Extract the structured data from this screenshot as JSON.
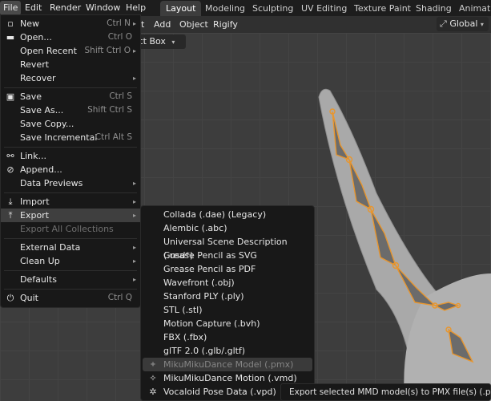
{
  "topbar": {
    "menus": [
      "File",
      "Edit",
      "Render",
      "Window",
      "Help"
    ],
    "workspaces": [
      "Layout",
      "Modeling",
      "Sculpting",
      "UV Editing",
      "Texture Paint",
      "Shading",
      "Animatio"
    ]
  },
  "header": {
    "mode_menu_fragment": "t",
    "menus": [
      "Add",
      "Object",
      "Rigify"
    ],
    "transform_orientation": "Global"
  },
  "toolbar": {
    "select_box": "elect Box"
  },
  "file_menu": {
    "new": {
      "label": "New",
      "shortcut": "Ctrl N"
    },
    "open": {
      "label": "Open...",
      "shortcut": "Ctrl O"
    },
    "open_recent": {
      "label": "Open Recent",
      "shortcut": "Shift Ctrl O"
    },
    "revert": {
      "label": "Revert"
    },
    "recover": {
      "label": "Recover"
    },
    "save": {
      "label": "Save",
      "shortcut": "Ctrl S"
    },
    "save_as": {
      "label": "Save As...",
      "shortcut": "Shift Ctrl S"
    },
    "save_copy": {
      "label": "Save Copy..."
    },
    "save_incremental": {
      "label": "Save Incremental",
      "shortcut": "Ctrl Alt S"
    },
    "link": {
      "label": "Link..."
    },
    "append": {
      "label": "Append..."
    },
    "data_previews": {
      "label": "Data Previews"
    },
    "import": {
      "label": "Import"
    },
    "export": {
      "label": "Export"
    },
    "export_all_collections": {
      "label": "Export All Collections"
    },
    "external_data": {
      "label": "External Data"
    },
    "clean_up": {
      "label": "Clean Up"
    },
    "defaults": {
      "label": "Defaults"
    },
    "quit": {
      "label": "Quit",
      "shortcut": "Ctrl Q"
    }
  },
  "export_menu": {
    "items": [
      "Collada (.dae) (Legacy)",
      "Alembic (.abc)",
      "Universal Scene Description (.usd*)",
      "Grease Pencil as SVG",
      "Grease Pencil as PDF",
      "Wavefront (.obj)",
      "Stanford PLY (.ply)",
      "STL (.stl)",
      "Motion Capture (.bvh)",
      "FBX (.fbx)",
      "glTF 2.0 (.glb/.gltf)",
      "MikuMikuDance Model (.pmx)",
      "MikuMikuDance Motion (.vmd)",
      "Vocaloid Pose Data (.vpd)"
    ]
  },
  "tooltip": {
    "text": "Export selected MMD model(s) to PMX file(s) (.pmx)."
  },
  "colors": {
    "bone_orange": "#e8962e",
    "mesh_gray": "#a8a8a8",
    "menu_bg": "#181818"
  }
}
